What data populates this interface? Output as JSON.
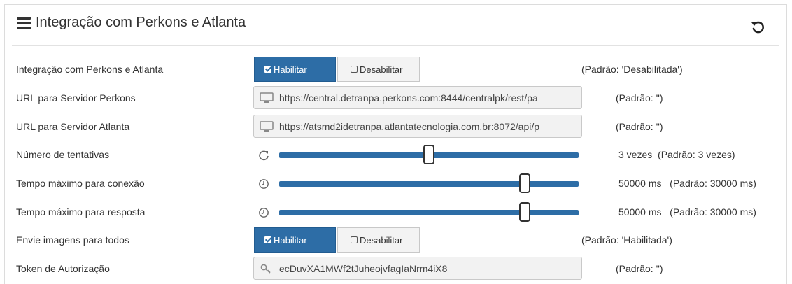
{
  "header": {
    "title": "Integração com Perkons e Atlanta",
    "menu_icon": "list-icon",
    "reset_icon": "undo-icon"
  },
  "rows": [
    {
      "label": "Integração com Perkons e Atlanta",
      "enable_label": "Habilitar",
      "disable_label": "Desabilitar",
      "state": "enabled",
      "default": "(Padrão: 'Desabilitada')"
    },
    {
      "label": "URL para Servidor Perkons",
      "value": "https://central.detranpa.perkons.com:8444/centralpk/rest/pa",
      "icon": "monitor-icon",
      "default": "(Padrão: '')"
    },
    {
      "label": "URL para Servidor Atlanta",
      "value": "https://atsmd2idetranpa.atlantatecnologia.com.br:8072/api/p",
      "icon": "monitor-icon",
      "default": "(Padrão: '')"
    },
    {
      "label": "Número de tentativas",
      "icon": "refresh-icon",
      "level": 0.5,
      "value": "3 vezes",
      "default": "(Padrão: 3 vezes)"
    },
    {
      "label": "Tempo máximo para conexão",
      "icon": "clock-icon",
      "level": 0.82,
      "value": "50000 ms",
      "default": "(Padrão: 30000 ms)"
    },
    {
      "label": "Tempo máximo para resposta",
      "icon": "clock-icon",
      "level": 0.82,
      "value": "50000 ms",
      "default": "(Padrão: 30000 ms)"
    },
    {
      "label": "Envie imagens para todos",
      "enable_label": "Habilitar",
      "disable_label": "Desabilitar",
      "state": "enabled",
      "default": "(Padrão: 'Habilitada')"
    },
    {
      "label": "Token de Autorização",
      "value": "ecDuvXA1MWf2tJuheojvfagIaNrm4iX8",
      "icon": "key-icon",
      "default": "(Padrão: '')"
    }
  ],
  "colors": {
    "accent": "#2d6da6",
    "field_bg": "#f2f2f2",
    "button_off_bg": "#f3f3f3"
  }
}
